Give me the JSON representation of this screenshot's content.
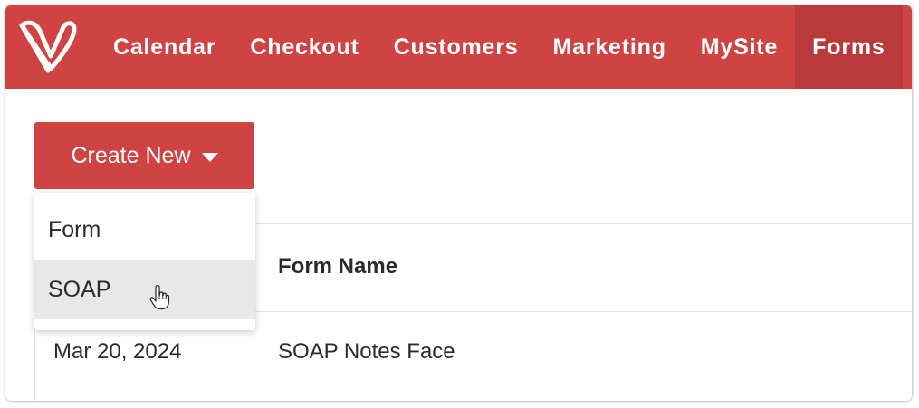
{
  "nav": {
    "items": [
      {
        "label": "Calendar"
      },
      {
        "label": "Checkout"
      },
      {
        "label": "Customers"
      },
      {
        "label": "Marketing"
      },
      {
        "label": "MySite"
      },
      {
        "label": "Forms"
      }
    ],
    "active": "Forms"
  },
  "toolbar": {
    "create_label": "Create New"
  },
  "dropdown": {
    "items": [
      {
        "label": "Form"
      },
      {
        "label": "SOAP"
      }
    ],
    "hovered": "SOAP"
  },
  "table": {
    "columns": {
      "name": "Form Name"
    },
    "rows": [
      {
        "date": "Mar 20, 2024",
        "name": "SOAP Notes Face"
      }
    ]
  },
  "colors": {
    "brand": "#cf4343",
    "brand_active": "#b93a3a",
    "hover_bg": "#e8e8e8"
  },
  "icons": {
    "logo": "v-heart-logo-icon",
    "caret": "caret-down-icon",
    "cursor": "hand-pointer-icon"
  }
}
